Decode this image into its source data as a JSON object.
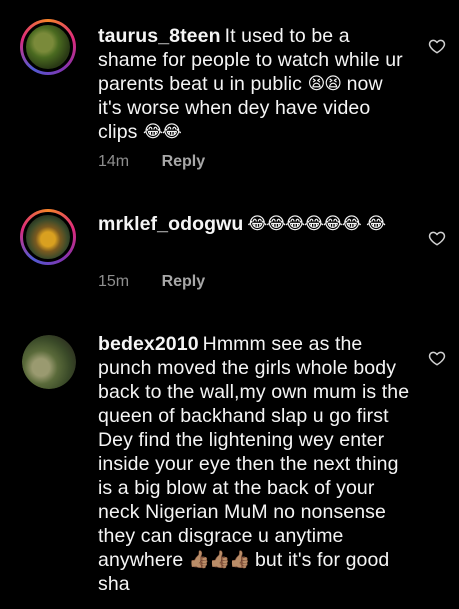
{
  "comments": [
    {
      "username": "taurus_8teen",
      "text": "It used to be a shame for people to watch while ur parents beat u in public",
      "emoji_1": "😫😫",
      "text_2": "now it's worse when dey have video clips",
      "emoji_2": "😂😂",
      "time": "14m",
      "reply_label": "Reply",
      "avatar_icon": "avatar-photo-icon"
    },
    {
      "username": "mrklef_odogwu",
      "emoji_1": "😂😂😂😂😂😂",
      "emoji_2": "😂",
      "time": "15m",
      "reply_label": "Reply",
      "avatar_icon": "avatar-photo-icon"
    },
    {
      "username": "bedex2010",
      "text": "Hmmm see as the punch moved the girls whole body back to the wall,my own mum is the queen of backhand slap u go first Dey find the lightening wey enter inside your eye then the next thing is a big blow at the back of your neck Nigerian MuM no nonsense they can disgrace u anytime anywhere",
      "emoji_1": "👍🏽👍🏽👍🏽",
      "text_2": "but it's for good sha",
      "avatar_icon": "avatar-photo-icon"
    }
  ],
  "colors": {
    "background": "#000000",
    "text": "#f5f5f5",
    "meta": "#8e8e8e",
    "story_ring": "#dd2a7b"
  }
}
